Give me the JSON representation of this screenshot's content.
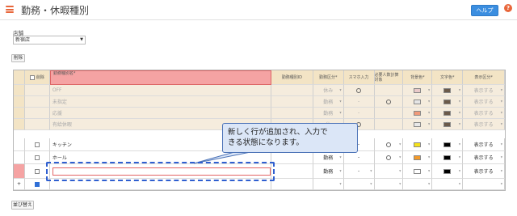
{
  "header": {
    "title": "勤務・休暇種別",
    "help_label": "ヘルプ",
    "help_icon": "?"
  },
  "store": {
    "label": "店舗",
    "selected": "新宿店"
  },
  "toolbar": {
    "delete_label": "削除",
    "sort_label": "並び替え"
  },
  "grid": {
    "headers": {
      "delete": "削除",
      "name": "勤務種別名*",
      "id": "勤務種別ID",
      "category": "勤務区分*",
      "smartphone": "スマホ入力",
      "required": "必要人数計算対象",
      "bg_color": "背景色*",
      "text_color": "文字色*",
      "display": "表示区分*"
    },
    "fixed_rows": [
      {
        "name": "OFF",
        "category": "休み",
        "smartphone": "○",
        "required": "",
        "bg": "#e9c9c9",
        "fg": "#6b5a4a",
        "display": "表示する"
      },
      {
        "name": "未指定",
        "category": "勤務",
        "smartphone": "-",
        "required": "○",
        "bg": "#e5e5e5",
        "fg": "#6b5a4a",
        "display": "表示する"
      },
      {
        "name": "応援",
        "category": "勤務",
        "smartphone": "-",
        "required": "",
        "bg": "#f09a7a",
        "fg": "#6b5a4a",
        "display": "表示する"
      },
      {
        "name": "有給休暇",
        "category": "休",
        "smartphone": "○",
        "required": "",
        "bg": "#e8e8e8",
        "fg": "#6b5a4a",
        "display": "表示する"
      }
    ],
    "rows": [
      {
        "name": "キッチン",
        "category": "勤",
        "smartphone": "-",
        "required": "○",
        "bg": "#f5e21a",
        "fg": "#000000",
        "display": "表示する"
      },
      {
        "name": "ホール",
        "category": "勤務",
        "smartphone": "-",
        "required": "○",
        "bg": "#f39a2a",
        "fg": "#000000",
        "display": "表示する"
      },
      {
        "name": "",
        "category": "勤務",
        "smartphone": "-",
        "required": "",
        "bg": "#ffffff",
        "fg": "#000000",
        "display": "表示する"
      }
    ],
    "add_row_symbol": "+"
  },
  "callout": {
    "line1": "新しく行が追加され、入力で",
    "line2": "きる状態になります。"
  },
  "colors": {
    "accent": "#e8663a",
    "primary": "#3b8ee0",
    "header_bg": "#f3e4c5",
    "highlight": "#f5a3a3",
    "callout_bg": "#dbe6f7"
  }
}
